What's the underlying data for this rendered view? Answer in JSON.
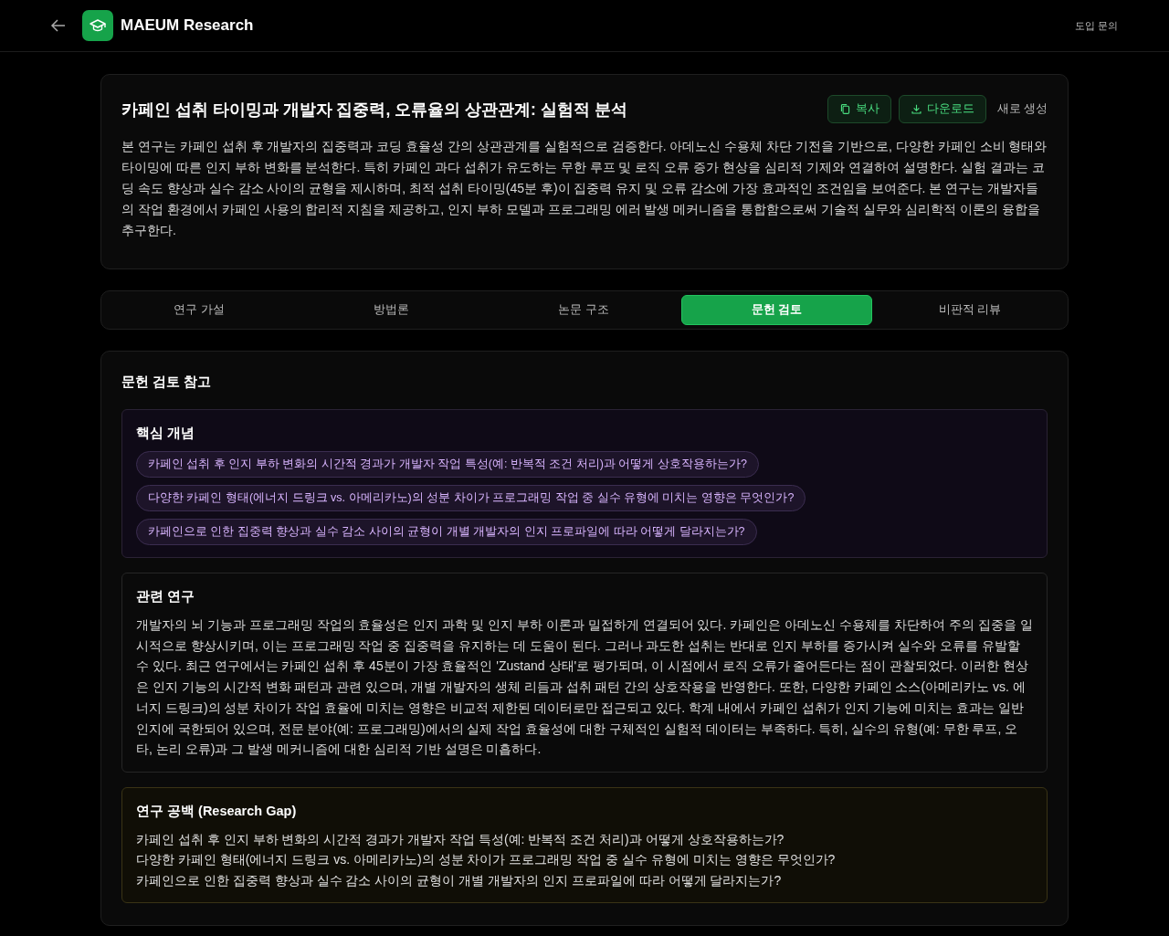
{
  "header": {
    "brand": "MAEUM Research",
    "nav_link": "도입 문의"
  },
  "paper": {
    "title": "카페인 섭취 타이밍과 개발자 집중력, 오류율의 상관관계: 실험적 분석",
    "actions": [
      {
        "kind": "copy",
        "label": "복사"
      },
      {
        "kind": "download",
        "label": "다운로드"
      },
      {
        "kind": "plain",
        "label": "새로 생성"
      }
    ],
    "abstract": "본 연구는 카페인 섭취 후 개발자의 집중력과 코딩 효율성 간의 상관관계를 실험적으로 검증한다. 아데노신 수용체 차단 기전을 기반으로, 다양한 카페인 소비 형태와 타이밍에 따른 인지 부하 변화를 분석한다. 특히 카페인 과다 섭취가 유도하는 무한 루프 및 로직 오류 증가 현상을 심리적 기제와 연결하여 설명한다. 실험 결과는 코딩 속도 향상과 실수 감소 사이의 균형을 제시하며, 최적 섭취 타이밍(45분 후)이 집중력 유지 및 오류 감소에 가장 효과적인 조건임을 보여준다. 본 연구는 개발자들의 작업 환경에서 카페인 사용의 합리적 지침을 제공하고, 인지 부하 모델과 프로그래밍 에러 발생 메커니즘을 통합함으로써 기술적 실무와 심리학적 이론의 융합을 추구한다."
  },
  "tabs": [
    {
      "label": "연구 가설",
      "selected": false
    },
    {
      "label": "방법론",
      "selected": false
    },
    {
      "label": "논문 구조",
      "selected": false
    },
    {
      "label": "문헌 검토",
      "selected": true
    },
    {
      "label": "비판적 리뷰",
      "selected": false
    }
  ],
  "literature": {
    "title": "문헌 검토 참고",
    "sections": [
      {
        "kind": "chips",
        "title": "핵심 개념",
        "items": [
          "카페인 섭취 후 인지 부하 변화의 시간적 경과가 개발자 작업 특성(예: 반복적 조건 처리)과 어떻게 상호작용하는가?",
          "다양한 카페인 형태(에너지 드링크 vs. 아메리카노)의 성분 차이가 프로그래밍 작업 중 실수 유형에 미치는 영향은 무엇인가?",
          "카페인으로 인한 집중력 향상과 실수 감소 사이의 균형이 개별 개발자의 인지 프로파일에 따라 어떻게 달라지는가?"
        ]
      },
      {
        "kind": "text",
        "title": "관련 연구",
        "text": "개발자의 뇌 기능과 프로그래밍 작업의 효율성은 인지 과학 및 인지 부하 이론과 밀접하게 연결되어 있다. 카페인은 아데노신 수용체를 차단하여 주의 집중을 일시적으로 향상시키며, 이는 프로그래밍 작업 중 집중력을 유지하는 데 도움이 된다. 그러나 과도한 섭취는 반대로 인지 부하를 증가시켜 실수와 오류를 유발할 수 있다. 최근 연구에서는 카페인 섭취 후 45분이 가장 효율적인 'Zustand 상태'로 평가되며, 이 시점에서 로직 오류가 줄어든다는 점이 관찰되었다. 이러한 현상은 인지 기능의 시간적 변화 패턴과 관련 있으며, 개별 개발자의 생체 리듬과 섭취 패턴 간의 상호작용을 반영한다. 또한, 다양한 카페인 소스(아메리카노 vs. 에너지 드링크)의 성분 차이가 작업 효율에 미치는 영향은 비교적 제한된 데이터로만 접근되고 있다. 학계 내에서 카페인 섭취가 인지 기능에 미치는 효과는 일반 인지에 국한되어 있으며, 전문 분야(예: 프로그래밍)에서의 실제 작업 효율성에 대한 구체적인 실험적 데이터는 부족하다. 특히, 실수의 유형(예: 무한 루프, 오타, 논리 오류)과 그 발생 메커니즘에 대한 심리적 기반 설명은 미흡하다."
      },
      {
        "kind": "lines",
        "title": "연구 공백 (Research Gap)",
        "items": [
          "카페인 섭취 후 인지 부하 변화의 시간적 경과가 개발자 작업 특성(예: 반복적 조건 처리)과 어떻게 상호작용하는가?",
          "다양한 카페인 형태(에너지 드링크 vs. 아메리카노)의 성분 차이가 프로그래밍 작업 중 실수 유형에 미치는 영향은 무엇인가?",
          "카페인으로 인한 집중력 향상과 실수 감소 사이의 균형이 개별 개발자의 인지 프로파일에 따라 어떻게 달라지는가?"
        ]
      }
    ]
  }
}
